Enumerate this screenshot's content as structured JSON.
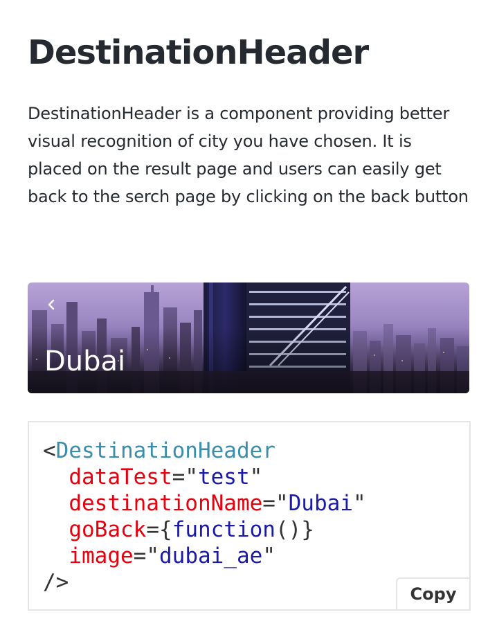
{
  "page": {
    "title": "DestinationHeader",
    "description": "DestinationHeader is a component providing better visual recognition of city you have chosen. It is placed on the result page and users can easily get back to the serch page by clicking on the back button"
  },
  "example": {
    "destination_name": "Dubai",
    "back_icon": "chevron-left-icon",
    "image_subject": "dubai-skyline"
  },
  "code": {
    "open_bracket": "<",
    "component": "DestinationHeader",
    "props": [
      {
        "name": "dataTest",
        "eq": "=",
        "open": "\"",
        "value": "test",
        "close": "\""
      },
      {
        "name": "destinationName",
        "eq": "=",
        "open": "\"",
        "value": "Dubai",
        "close": "\""
      },
      {
        "name": "goBack",
        "eq": "=",
        "open": "{",
        "value": "function",
        "close": "()}"
      },
      {
        "name": "image",
        "eq": "=",
        "open": "\"",
        "value": "dubai_ae",
        "close": "\""
      }
    ],
    "close_tag": "/>",
    "copy_label": "Copy"
  },
  "colors": {
    "text": "#252a31",
    "tag": "#3a8dab",
    "attr": "#e6000e",
    "string": "#1a1aa6",
    "border": "#e5e5e5"
  }
}
